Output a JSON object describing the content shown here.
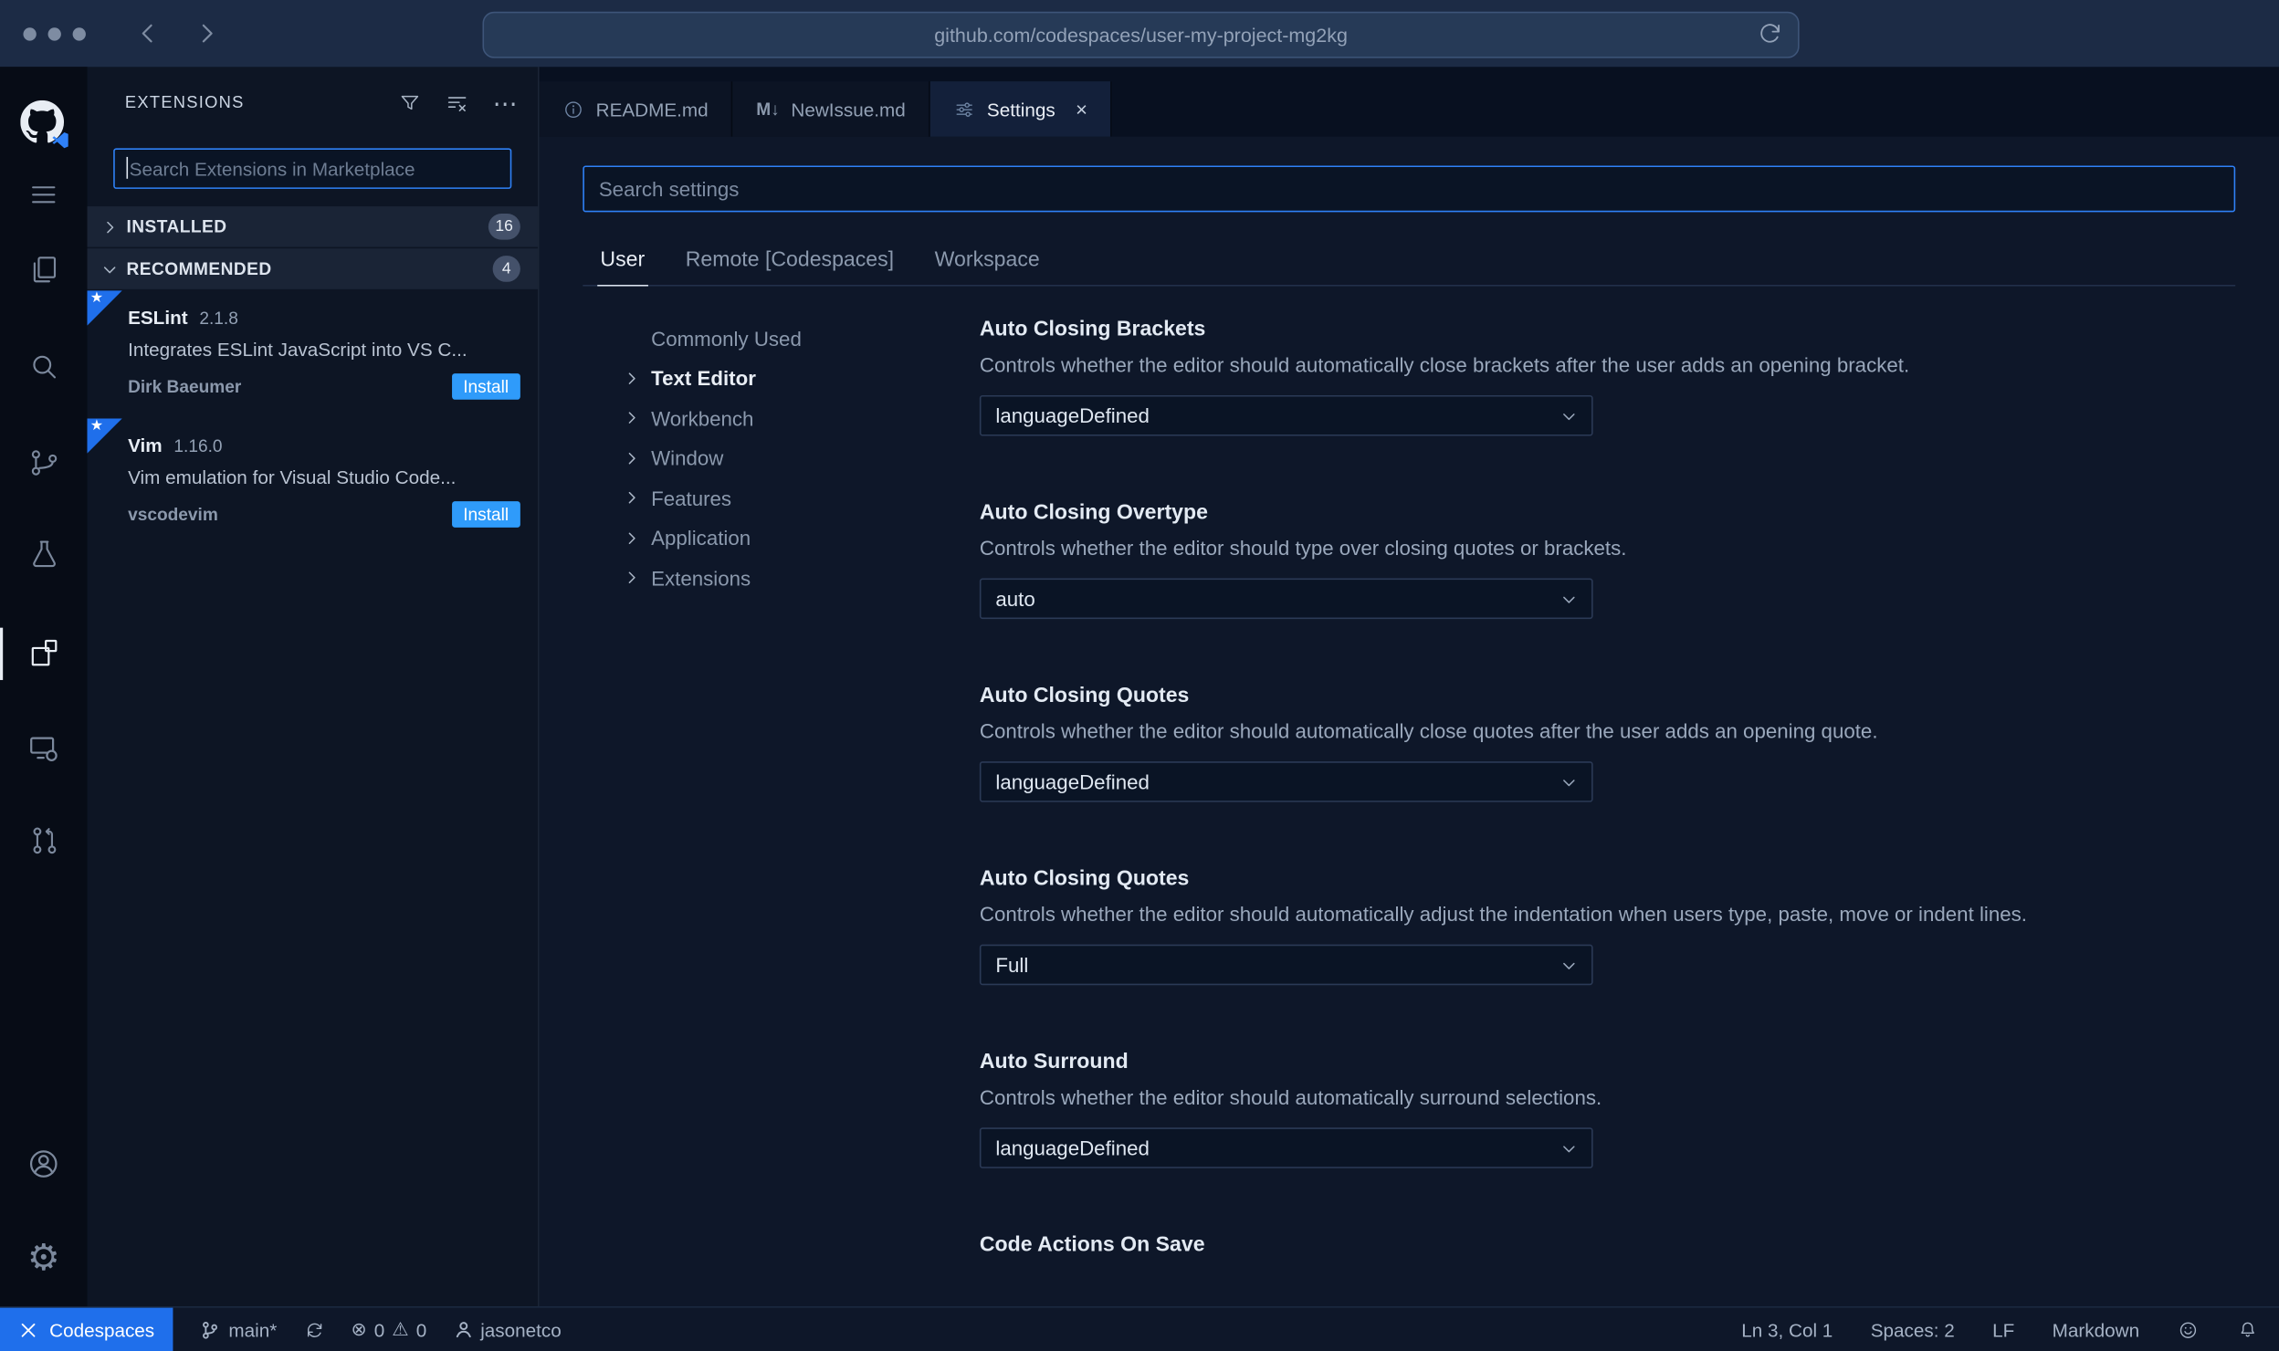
{
  "browser": {
    "url": "github.com/codespaces/user-my-project-mg2kg"
  },
  "icons": {
    "gear": "⚙",
    "warning": "⚠",
    "error": "⊗",
    "more": "⋯",
    "close": "×",
    "star": "★",
    "markdown_tab": "M↓"
  },
  "sidebar": {
    "title": "EXTENSIONS",
    "search_placeholder": "Search Extensions in Marketplace",
    "sections": [
      {
        "label": "INSTALLED",
        "badge": "16"
      },
      {
        "label": "RECOMMENDED",
        "badge": "4"
      }
    ],
    "extensions": [
      {
        "name": "ESLint",
        "version": "2.1.8",
        "description": "Integrates ESLint JavaScript into VS C...",
        "author": "Dirk Baeumer",
        "action": "Install"
      },
      {
        "name": "Vim",
        "version": "1.16.0",
        "description": "Vim emulation for Visual Studio Code...",
        "author": "vscodevim",
        "action": "Install"
      }
    ]
  },
  "tabs": [
    {
      "label": "README.md"
    },
    {
      "label": "NewIssue.md"
    },
    {
      "label": "Settings"
    }
  ],
  "settings_editor": {
    "search_placeholder": "Search settings",
    "scopes": [
      {
        "label": "User"
      },
      {
        "label": "Remote [Codespaces]"
      },
      {
        "label": "Workspace"
      }
    ],
    "toc": [
      {
        "label": "Commonly Used"
      },
      {
        "label": "Text Editor"
      },
      {
        "label": "Workbench"
      },
      {
        "label": "Window"
      },
      {
        "label": "Features"
      },
      {
        "label": "Application"
      },
      {
        "label": "Extensions"
      }
    ],
    "items": [
      {
        "title": "Auto Closing Brackets",
        "description": "Controls whether the editor should automatically close brackets after the user adds an opening bracket.",
        "value": "languageDefined"
      },
      {
        "title": "Auto Closing Overtype",
        "description": "Controls whether the editor should type over closing quotes or brackets.",
        "value": "auto"
      },
      {
        "title": "Auto Closing Quotes",
        "description": "Controls whether the editor should automatically close quotes after the user adds an opening quote.",
        "value": "languageDefined"
      },
      {
        "title": "Auto Closing Quotes",
        "description": "Controls whether the editor should automatically adjust the indentation when users type, paste, move or indent lines.",
        "value": "Full"
      },
      {
        "title": "Auto Surround",
        "description": "Controls whether the editor should automatically surround selections.",
        "value": "languageDefined"
      },
      {
        "title": "Code Actions On Save",
        "description": "",
        "value": ""
      }
    ]
  },
  "status_bar": {
    "codespaces": "Codespaces",
    "branch": "main*",
    "errors": "0",
    "warnings": "0",
    "user": "jasonetco",
    "line_col": "Ln 3, Col 1",
    "spaces": "Spaces: 2",
    "eol": "LF",
    "language": "Markdown"
  }
}
